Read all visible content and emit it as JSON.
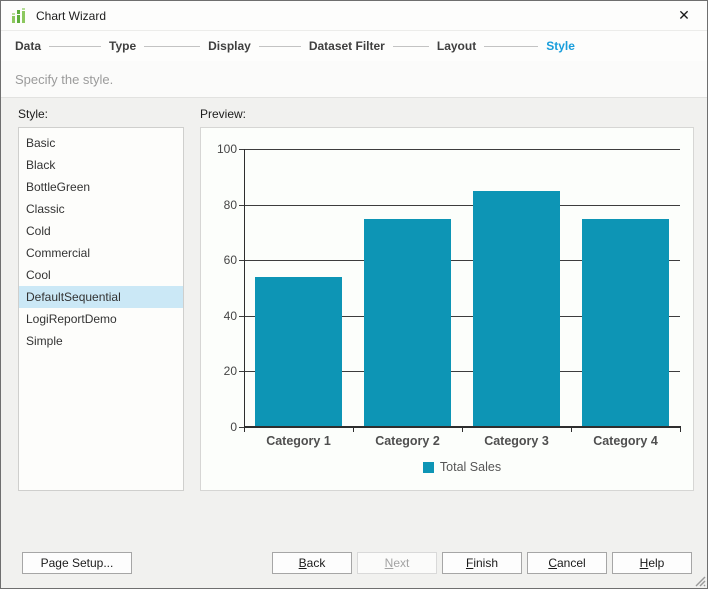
{
  "window": {
    "title": "Chart Wizard",
    "close_glyph": "✕"
  },
  "steps": {
    "items": [
      {
        "label": "Data",
        "active": false
      },
      {
        "label": "Type",
        "active": false
      },
      {
        "label": "Display",
        "active": false
      },
      {
        "label": "Dataset Filter",
        "active": false
      },
      {
        "label": "Layout",
        "active": false
      },
      {
        "label": "Style",
        "active": true
      }
    ]
  },
  "subtitle": "Specify the style.",
  "style_panel": {
    "label": "Style:",
    "options": [
      "Basic",
      "Black",
      "BottleGreen",
      "Classic",
      "Cold",
      "Commercial",
      "Cool",
      "DefaultSequential",
      "LogiReportDemo",
      "Simple"
    ],
    "selected": "DefaultSequential",
    "selected_index": 7
  },
  "preview_panel": {
    "label": "Preview:"
  },
  "chart_data": {
    "type": "bar",
    "categories": [
      "Category 1",
      "Category 2",
      "Category 3",
      "Category 4"
    ],
    "series": [
      {
        "name": "Total Sales",
        "values": [
          54,
          75,
          85,
          75
        ],
        "color": "#0d95b5"
      }
    ],
    "title": "",
    "xlabel": "",
    "ylabel": "",
    "ylim": [
      0,
      100
    ],
    "yticks": [
      0,
      20,
      40,
      60,
      80,
      100
    ],
    "grid": true,
    "legend_position": "bottom"
  },
  "buttons": {
    "page_setup": "Page Setup...",
    "back": "Back",
    "next": "Next",
    "finish": "Finish",
    "cancel": "Cancel",
    "help": "Help"
  },
  "colors": {
    "accent_blue": "#189ddb",
    "bar_teal": "#0d95b5",
    "selected_item_bg": "#cbe8f6",
    "icon_green": "#7cc152"
  }
}
